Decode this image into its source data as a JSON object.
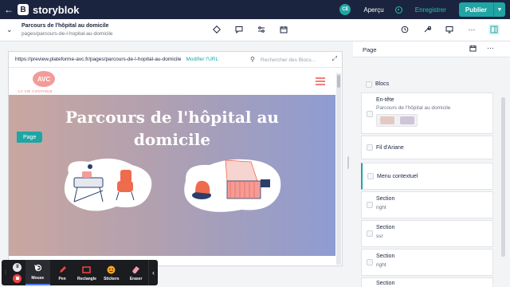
{
  "topbar": {
    "logo_letter": "B",
    "brand": "storyblok",
    "avatar_initials": "CE",
    "preview_label": "Aperçu",
    "save_label": "Enregistrer",
    "publish_label": "Publier"
  },
  "story": {
    "title": "Parcours de l'hôpital au domicile",
    "slug": "pages/parcours-de-l-hopital-au-domicile"
  },
  "preview": {
    "url": "https://preview.plateforme-avc.fr/pages/parcours-de-l-hopital-au-domicile",
    "edit_url_label": "Modifier l'URL",
    "search_placeholder": "Rechercher des Blocs...",
    "site_logo": "AVC",
    "site_tagline": "LA VIE CONTINUE",
    "hero_title": "Parcours de l'hôpital au domicile",
    "selected_block_tag": "Page"
  },
  "drawing_toolbar": {
    "tools": [
      {
        "label": "Mouse",
        "icon": "cursor-icon",
        "active": true
      },
      {
        "label": "Pen",
        "icon": "pen-icon",
        "active": false
      },
      {
        "label": "Rectangle",
        "icon": "rectangle-icon",
        "active": false
      },
      {
        "label": "Stickers",
        "icon": "sticker-icon",
        "active": false
      },
      {
        "label": "Eraser",
        "icon": "eraser-icon",
        "active": false
      }
    ]
  },
  "panel": {
    "title": "Page",
    "blocks_label": "Blocs",
    "items": [
      {
        "label": "En-tête",
        "subtitle": "Parcours de l'hôpital au domicile"
      },
      {
        "label": "Fil d'Ariane",
        "subtitle": ""
      },
      {
        "label": "Menu contextuel",
        "subtitle": ""
      },
      {
        "label": "Section",
        "subtitle": "right"
      },
      {
        "label": "Section",
        "subtitle": "ssr"
      },
      {
        "label": "Section",
        "subtitle": "right"
      },
      {
        "label": "Section",
        "subtitle": ""
      }
    ]
  },
  "colors": {
    "navy": "#1b243f",
    "teal": "#1fa5a4",
    "coral": "#f07f7a"
  }
}
